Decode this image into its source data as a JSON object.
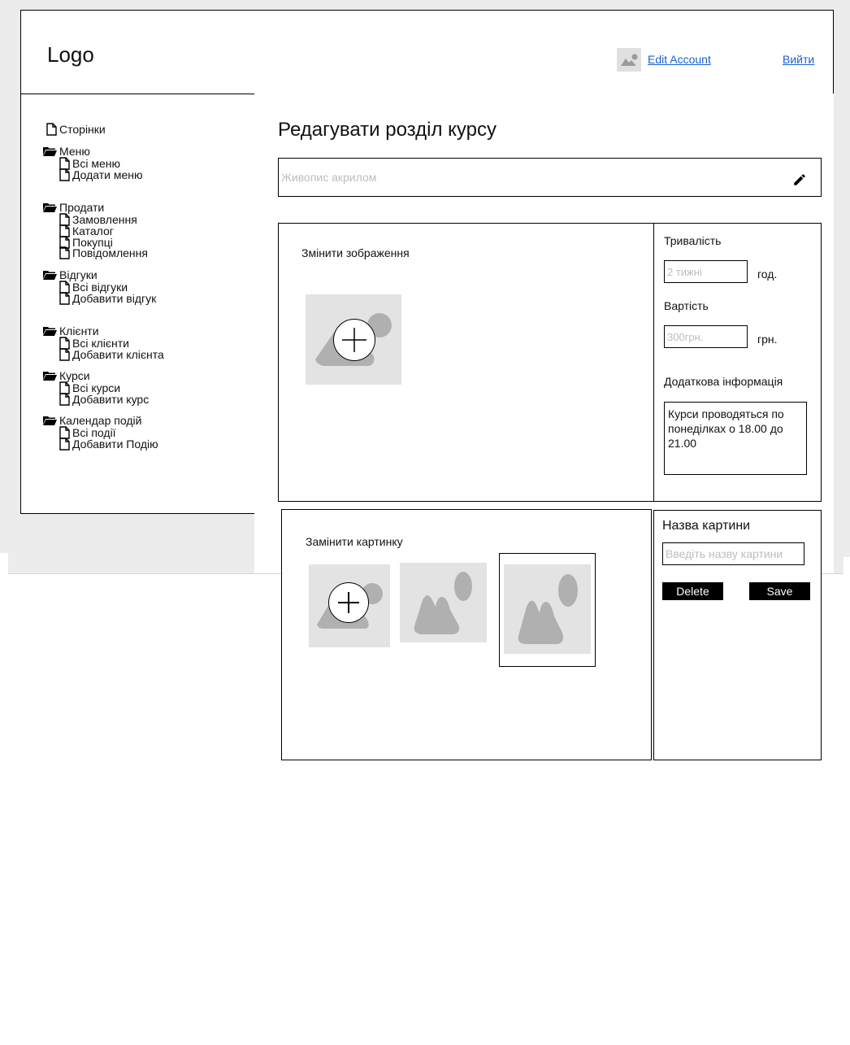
{
  "header": {
    "logo": "Logo",
    "edit_account": "Edit Account",
    "logout": "Вийти",
    "avatar_icon": "image-icon"
  },
  "sidebar": {
    "pages": "Сторінки",
    "groups": [
      {
        "label": "Меню",
        "items": [
          "Всі меню",
          "Додати меню"
        ]
      },
      {
        "label": "Продати",
        "items": [
          "Замовлення",
          "Каталог",
          "Покупці",
          "Повідомлення"
        ]
      },
      {
        "label": "Відгуки",
        "items": [
          "Всі відгуки",
          "Добавити відгук"
        ]
      },
      {
        "label": "Клієнти",
        "items": [
          "Всі клієнти",
          "Добавити клієнта"
        ]
      },
      {
        "label": "Курси",
        "items": [
          "Всі курси",
          "Добавити курс"
        ]
      },
      {
        "label": "Календар подій",
        "items": [
          "Всі події",
          "Добавити Подію"
        ]
      }
    ]
  },
  "main": {
    "title": "Редагувати розділ курсу",
    "course_name_placeholder": "Живопис акрилом",
    "change_image": "Змінити зображення",
    "duration_label": "Тривалість",
    "duration_placeholder": "2 тижні",
    "duration_unit": "год.",
    "price_label": "Вартість",
    "price_placeholder": "300грн.",
    "price_unit": "грн.",
    "extra_label": "Додаткова інформація",
    "extra_text": "Курси проводяться по понеділках о 18.00 до 21.00",
    "replace_picture": "Замінити картинку",
    "picture_name_label": "Назва картини",
    "picture_name_placeholder": "Введіть назву картини",
    "delete_btn": "Delete",
    "save_btn": "Save"
  }
}
